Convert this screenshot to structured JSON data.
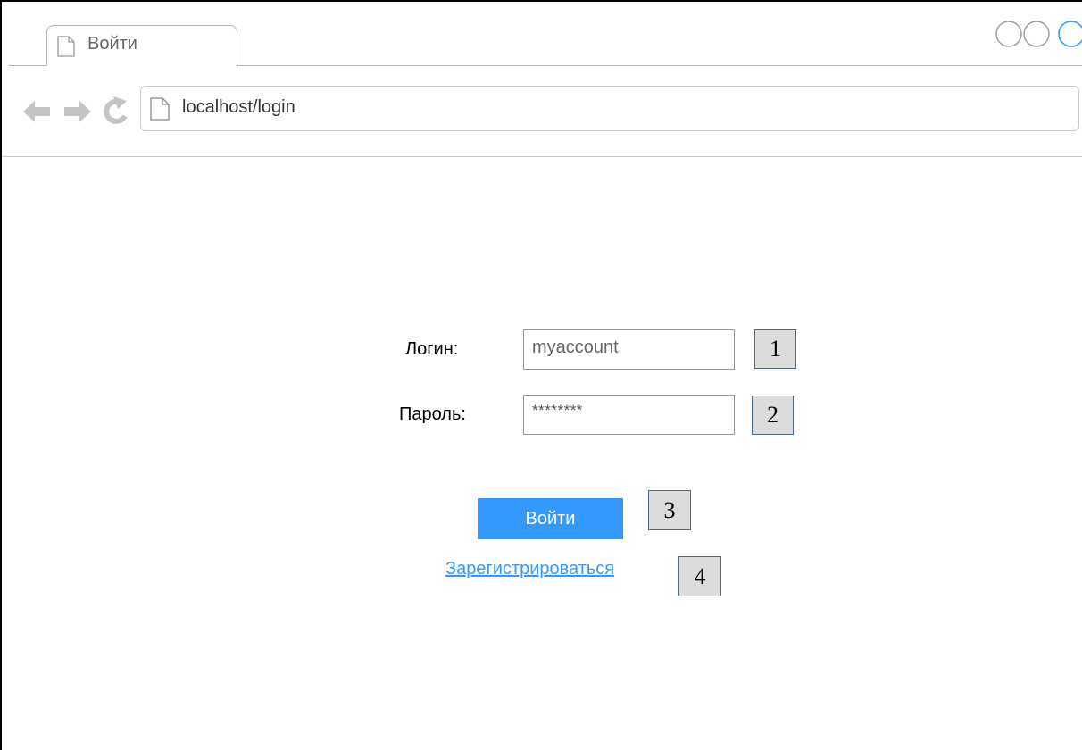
{
  "browser": {
    "tab": {
      "title": "Войти",
      "icon": "page-icon"
    },
    "window_controls": [
      "circle-button",
      "circle-button",
      "circle-button-active"
    ],
    "nav": {
      "back": "back-arrow-icon",
      "forward": "forward-arrow-icon",
      "reload": "reload-icon"
    },
    "url": "localhost/login"
  },
  "form": {
    "login": {
      "label": "Логин:",
      "value": "myaccount",
      "marker": "1"
    },
    "password": {
      "label": "Пароль:",
      "value": "********",
      "marker": "2"
    },
    "submit": {
      "label": "Войти",
      "marker": "3"
    },
    "register": {
      "label": "Зарегистрироваться",
      "marker": "4"
    }
  },
  "colors": {
    "accent": "#3399ff",
    "marker_bg": "#dcdcdc",
    "chrome_border": "#b3b3b3"
  }
}
